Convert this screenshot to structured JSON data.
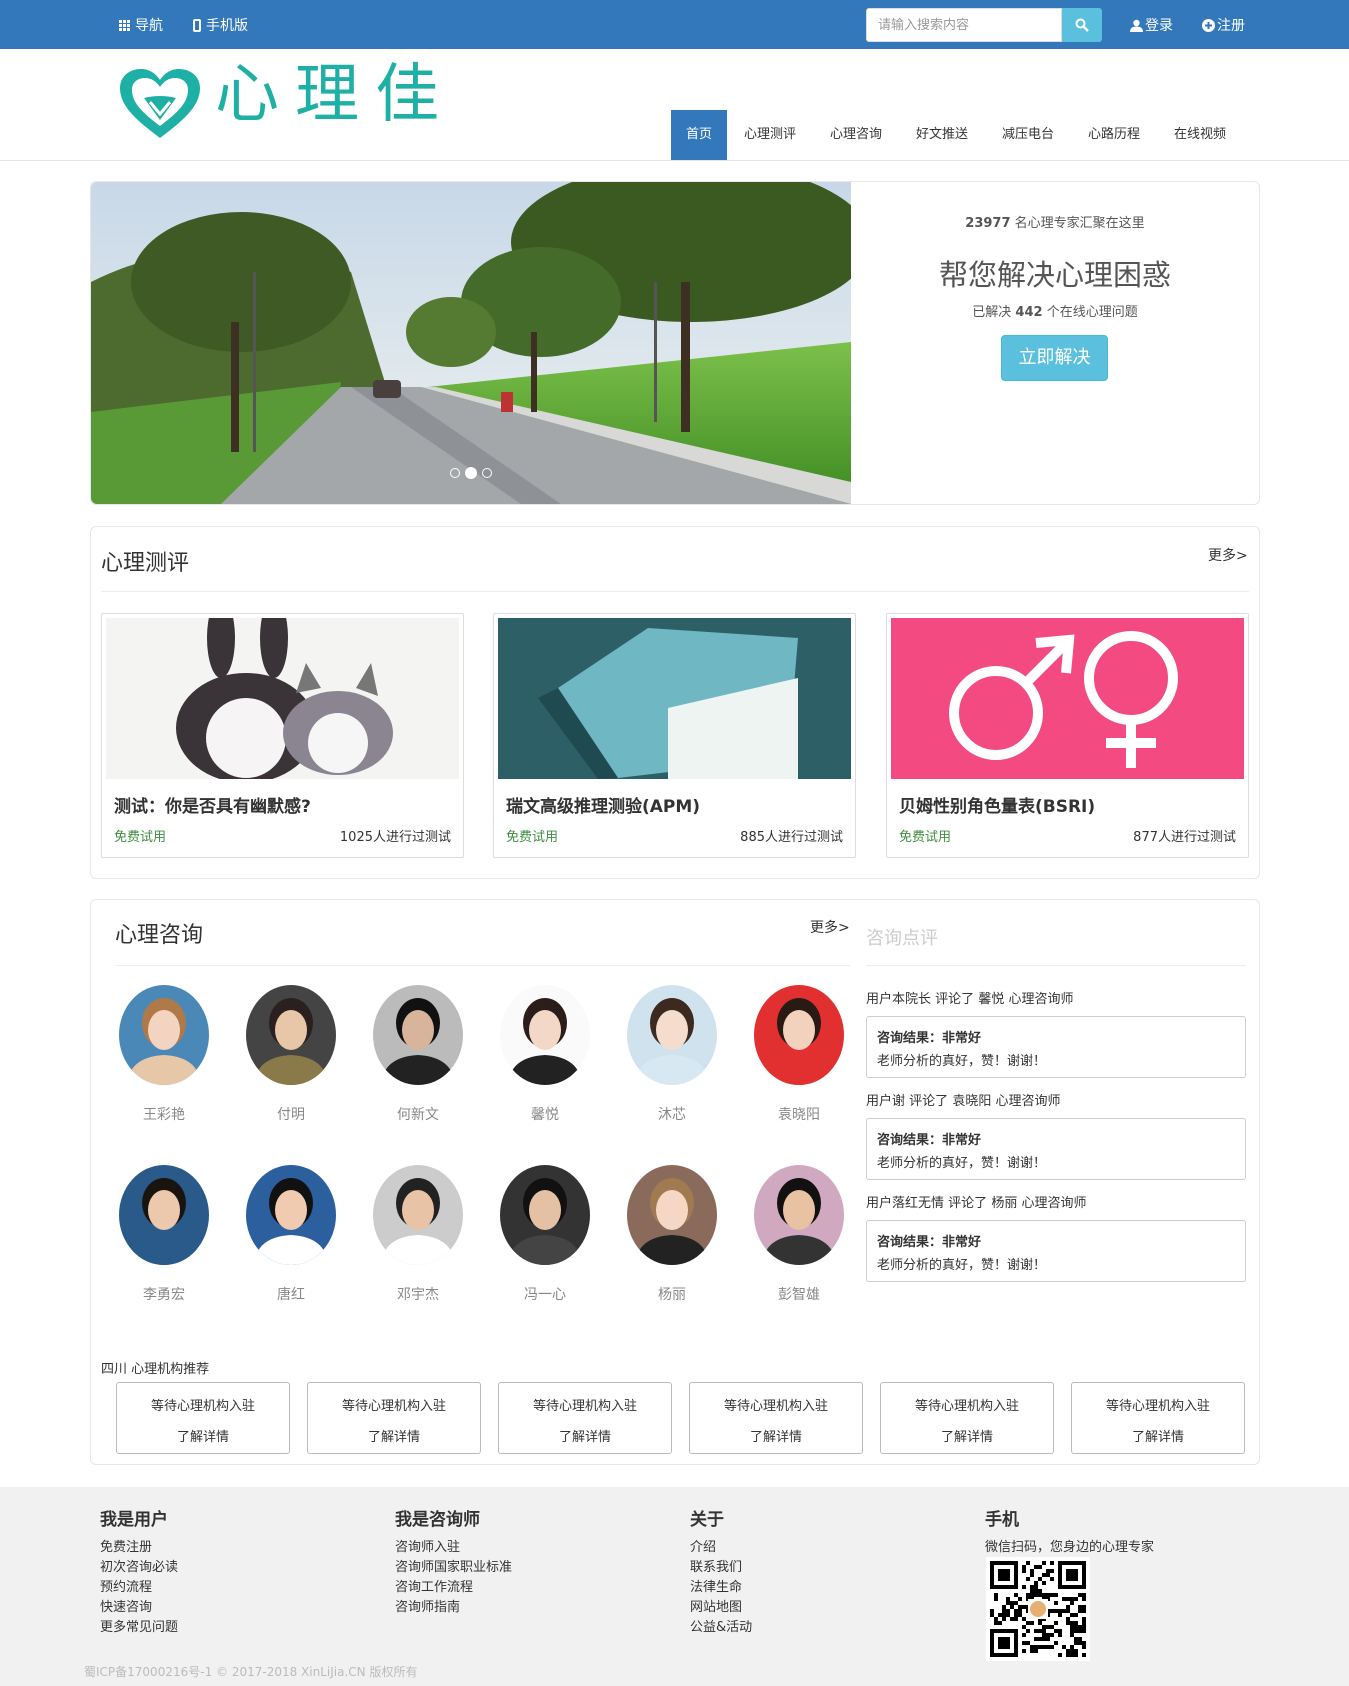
{
  "topbar": {
    "nav_label": "导航",
    "mobile_label": "手机版",
    "search_placeholder": "请输入搜索内容",
    "login_label": "登录",
    "register_label": "注册"
  },
  "logo": {
    "text": "心理佳"
  },
  "nav": {
    "items": [
      "首页",
      "心理测评",
      "心理咨询",
      "好文推送",
      "减压电台",
      "心路历程",
      "在线视频"
    ],
    "active": 0
  },
  "hero": {
    "experts_count": "23977",
    "experts_text": "名心理专家汇聚在这里",
    "headline": "帮您解决心理困惑",
    "solved_prefix": "已解决",
    "solved_count": "442",
    "solved_suffix": "个在线心理问题",
    "cta": "立即解决",
    "slides": 3,
    "active_slide": 1
  },
  "tests": {
    "title": "心理测评",
    "more": "更多>",
    "cards": [
      {
        "title": "测试：你是否具有幽默感?",
        "free": "免费试用",
        "count": "1025人进行过测试"
      },
      {
        "title": "瑞文高级推理测验(APM)",
        "free": "免费试用",
        "count": "885人进行过测试"
      },
      {
        "title": "贝姆性别角色量表(BSRI)",
        "free": "免费试用",
        "count": "877人进行过测试"
      }
    ]
  },
  "consult": {
    "title": "心理咨询",
    "more": "更多>",
    "counselors": [
      "王彩艳",
      "付明",
      "何新文",
      "馨悦",
      "沐芯",
      "袁晓阳",
      "李勇宏",
      "唐红",
      "邓宇杰",
      "冯一心",
      "杨丽",
      "彭智雄"
    ]
  },
  "reviews": {
    "title": "咨询点评",
    "items": [
      {
        "user": "用户本院长",
        "action": "评论了",
        "counselor": "馨悦",
        "role": "心理咨询师",
        "result": "咨询结果：非常好",
        "comment": "老师分析的真好，赞！谢谢！"
      },
      {
        "user": "用户谢",
        "action": "评论了",
        "counselor": "袁晓阳",
        "role": "心理咨询师",
        "result": "咨询结果：非常好",
        "comment": "老师分析的真好，赞！谢谢！"
      },
      {
        "user": "用户落红无情",
        "action": "评论了",
        "counselor": "杨丽",
        "role": "心理咨询师",
        "result": "咨询结果：非常好",
        "comment": "老师分析的真好，赞！谢谢！"
      }
    ]
  },
  "institutions": {
    "title": "四川 心理机构推荐",
    "items": [
      {
        "name": "等待心理机构入驻",
        "link": "了解详情"
      },
      {
        "name": "等待心理机构入驻",
        "link": "了解详情"
      },
      {
        "name": "等待心理机构入驻",
        "link": "了解详情"
      },
      {
        "name": "等待心理机构入驻",
        "link": "了解详情"
      },
      {
        "name": "等待心理机构入驻",
        "link": "了解详情"
      },
      {
        "name": "等待心理机构入驻",
        "link": "了解详情"
      }
    ]
  },
  "footer": {
    "cols": [
      {
        "title": "我是用户",
        "links": [
          "免费注册",
          "初次咨询必读",
          "预约流程",
          "快速咨询",
          "更多常见问题"
        ]
      },
      {
        "title": "我是咨询师",
        "links": [
          "咨询师入驻",
          "咨询师国家职业标准",
          "咨询工作流程",
          "咨询师指南"
        ]
      },
      {
        "title": "关于",
        "links": [
          "介绍",
          "联系我们",
          "法律生命",
          "网站地图",
          "公益&活动"
        ]
      }
    ],
    "mobile_title": "手机",
    "mobile_text": "微信扫码，您身边的心理专家",
    "copyright": "蜀ICP备17000216号-1 © 2017-2018 XinLiJia.CN 版权所有"
  },
  "colors": {
    "primary": "#3378ba",
    "info": "#5bc0de",
    "brand": "#1fb0a5",
    "free": "#3c8d3c"
  }
}
